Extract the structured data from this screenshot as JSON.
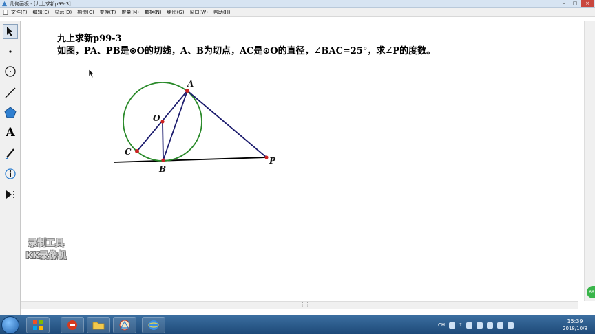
{
  "window": {
    "title": "几何画板 - [九上求新p99-3]",
    "minimize_glyph": "–",
    "maximize_glyph": "□",
    "close_glyph": "×"
  },
  "menu": {
    "items": [
      "文件(F)",
      "编辑(E)",
      "显示(D)",
      "构造(C)",
      "变换(T)",
      "度量(M)",
      "数据(N)",
      "绘图(G)",
      "窗口(W)",
      "帮助(H)"
    ]
  },
  "toolbox": {
    "tools": [
      "arrow-select",
      "point",
      "compass",
      "straightedge",
      "polygon",
      "text",
      "marker",
      "information",
      "custom-tools"
    ],
    "text_tool_glyph": "A"
  },
  "problem": {
    "title": "九上求新p99-3",
    "text": "如图，PA、PB是⊙O的切线，A、B为切点，AC是⊙O的直径，∠BAC=25°，求∠P的度数。"
  },
  "figure": {
    "labels": {
      "A": "A",
      "O": "O",
      "C": "C",
      "B": "B",
      "P": "P"
    },
    "colors": {
      "circle": "#2a8a2a",
      "segments": "#1c1c6e",
      "tangent_line": "#000000",
      "points": "#cc2222"
    }
  },
  "watermark": {
    "line1": "录制工具",
    "line2": "KK录像机"
  },
  "taskbar": {
    "tray_lang": "CH",
    "tray_ime": "?",
    "clock_time": "15:39",
    "clock_date": "2018/10/8"
  },
  "side_badge": "66"
}
